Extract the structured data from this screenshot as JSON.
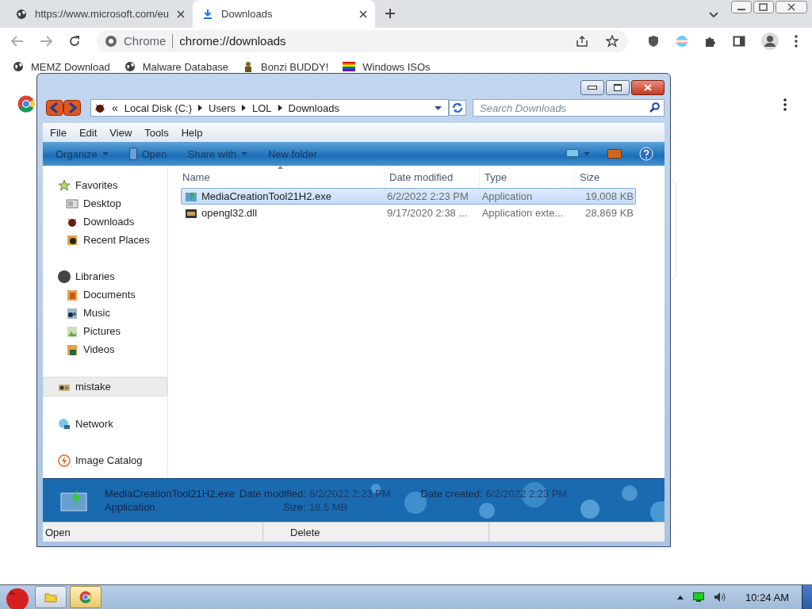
{
  "browser": {
    "tabs": [
      {
        "title": "https://www.microsoft.com/eu",
        "selected": false
      },
      {
        "title": "Downloads",
        "selected": true
      }
    ],
    "omnibox": {
      "label": "Chrome",
      "url": "chrome://downloads"
    },
    "bookmarks": [
      {
        "label": "MEMZ Download"
      },
      {
        "label": "Malware Database"
      },
      {
        "label": "Bonzi BUDDY!"
      },
      {
        "label": "Windows ISOs"
      }
    ]
  },
  "explorer": {
    "address": {
      "overflow": "«",
      "crumbs": [
        "Local Disk (C:)",
        "Users",
        "LOL",
        "Downloads"
      ]
    },
    "search": {
      "placeholder": "Search Downloads"
    },
    "menu": [
      "File",
      "Edit",
      "View",
      "Tools",
      "Help"
    ],
    "toolbar": [
      {
        "label": "Organize",
        "kind": "menu"
      },
      {
        "label": "Open",
        "kind": "action"
      },
      {
        "label": "Share with",
        "kind": "menu"
      },
      {
        "label": "New folder",
        "kind": "plain"
      }
    ],
    "nav": [
      {
        "label": "Favorites",
        "selected": false,
        "children": [
          {
            "label": "Desktop",
            "selected": false
          },
          {
            "label": "Downloads",
            "selected": false
          },
          {
            "label": "Recent Places",
            "selected": false
          }
        ]
      },
      {
        "label": "Libraries",
        "selected": false,
        "children": [
          {
            "label": "Documents",
            "selected": false
          },
          {
            "label": "Music",
            "selected": false
          },
          {
            "label": "Pictures",
            "selected": false
          },
          {
            "label": "Videos",
            "selected": false
          }
        ]
      },
      {
        "label": "mistake",
        "selected": true
      },
      {
        "label": "Network",
        "selected": false
      },
      {
        "label": "Image Catalog",
        "selected": false
      }
    ],
    "columns": [
      {
        "label": "Name",
        "sorted": true
      },
      {
        "label": "Date modified",
        "sorted": false
      },
      {
        "label": "Type",
        "sorted": false
      },
      {
        "label": "Size",
        "sorted": false
      }
    ],
    "rows": [
      {
        "cells": [
          "MediaCreationTool21H2.exe",
          "6/2/2022 2:23 PM",
          "Application",
          "19,008 KB"
        ],
        "selected": true
      },
      {
        "cells": [
          "opengl32.dll",
          "9/17/2020 2:38 ...",
          "Application exte...",
          "28,869 KB"
        ],
        "selected": false
      }
    ],
    "details": {
      "name": "MediaCreationTool21H2.exe",
      "type": "Application",
      "fields": [
        {
          "label": "Date modified:",
          "value": "6/2/2022 2:23 PM"
        },
        {
          "label": "Size:",
          "value": "18.5 MB"
        },
        {
          "label": "Date created:",
          "value": "6/2/2022 2:23 PM"
        }
      ]
    },
    "status": [
      "Open",
      "Delete"
    ]
  },
  "taskbar": {
    "items": [
      {
        "selected": false
      },
      {
        "selected": true
      }
    ],
    "clock": "10:24 AM"
  }
}
